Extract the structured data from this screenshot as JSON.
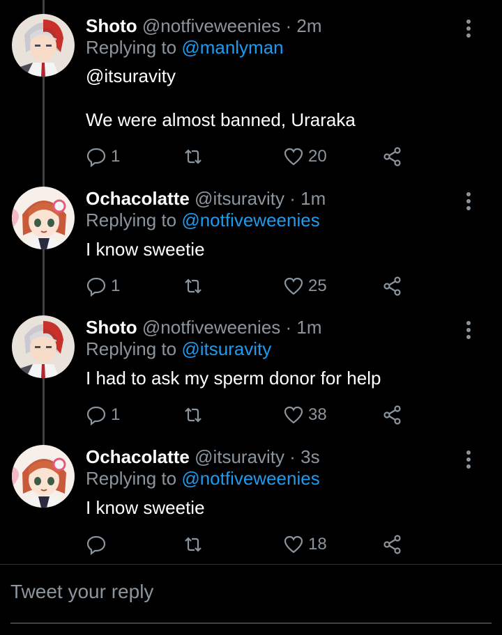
{
  "tweets": [
    {
      "name": "Shoto",
      "handle": "@notfiveweenies",
      "time": "· 2m",
      "replying_prefix": "Replying to",
      "replying_to": "@manlyman",
      "mention": "@itsuravity",
      "text": "We were almost banned, Uraraka",
      "replies": "1",
      "likes": "20",
      "avatar": "shoto"
    },
    {
      "name": "Ochacolatte",
      "handle": "@itsuravity",
      "time": "· 1m",
      "replying_prefix": "Replying to",
      "replying_to": "@notfiveweenies",
      "text": "I know sweetie",
      "replies": "1",
      "likes": "25",
      "avatar": "ochaco"
    },
    {
      "name": "Shoto",
      "handle": "@notfiveweenies",
      "time": "· 1m",
      "replying_prefix": "Replying to",
      "replying_to": "@itsuravity",
      "text": "I had to ask my sperm donor for help",
      "replies": "1",
      "likes": "38",
      "avatar": "shoto"
    },
    {
      "name": "Ochacolatte",
      "handle": "@itsuravity",
      "time": "· 3s",
      "replying_prefix": "Replying to",
      "replying_to": "@notfiveweenies",
      "text": "I know sweetie",
      "replies": "",
      "likes": "18",
      "avatar": "ochaco"
    }
  ],
  "reply_box": {
    "placeholder": "Tweet your reply"
  },
  "icons": {
    "reply": "reply-icon",
    "retweet": "retweet-icon",
    "like": "heart-icon",
    "share": "share-icon",
    "more": "more-vertical-icon"
  },
  "colors": {
    "background": "#000000",
    "link": "#1d9bf0",
    "muted": "#8b959e"
  }
}
